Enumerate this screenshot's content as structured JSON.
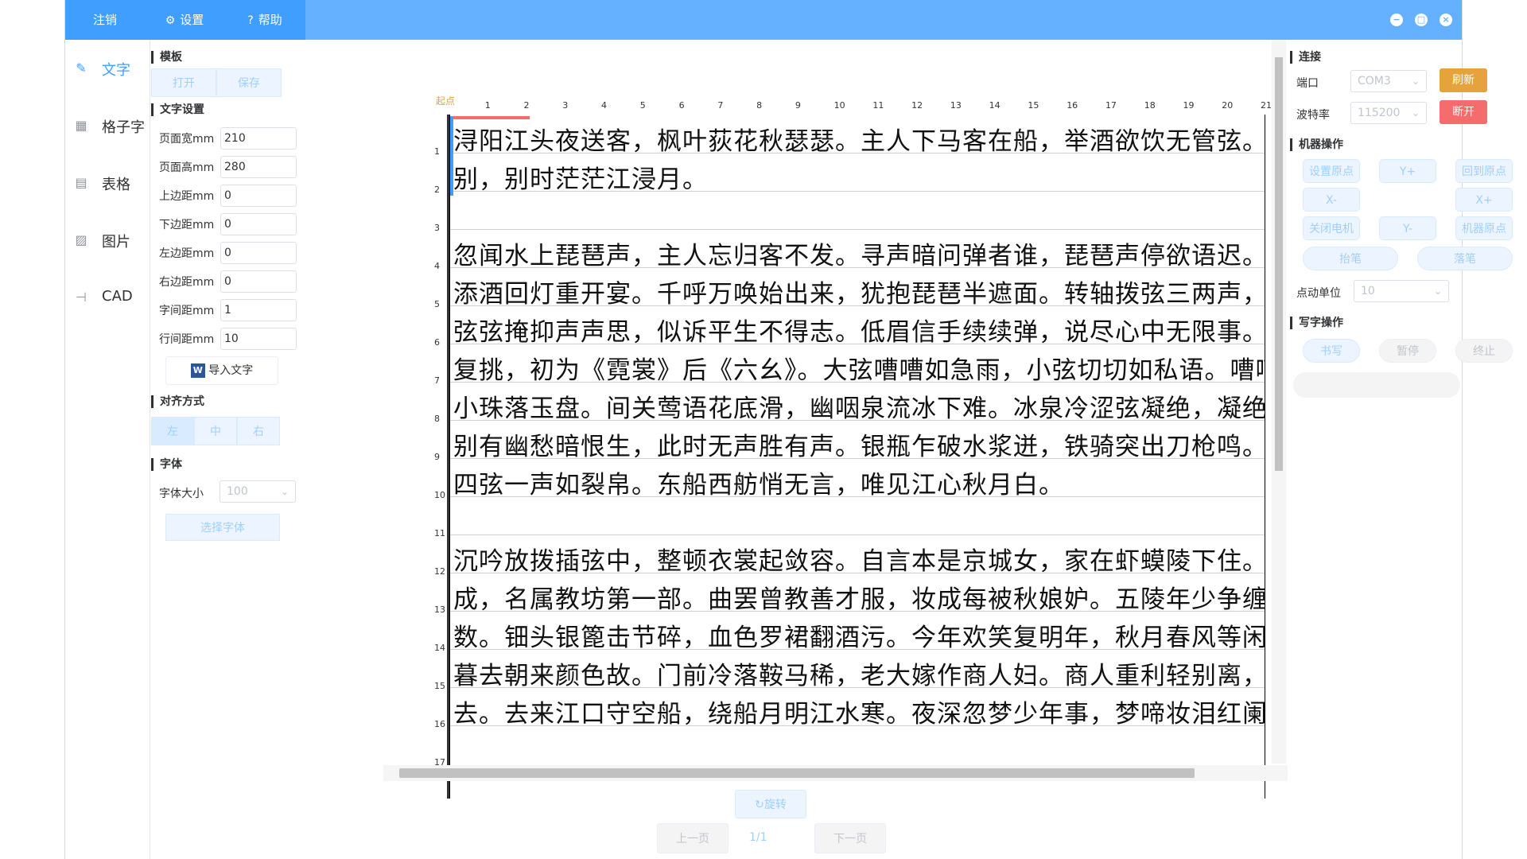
{
  "topbar": {
    "logout_label": "注销",
    "settings_label": "设置",
    "help_label": "帮助"
  },
  "nav": {
    "items": [
      {
        "label": "文字",
        "icon": "pen-icon"
      },
      {
        "label": "格子字",
        "icon": "grid-icon"
      },
      {
        "label": "表格",
        "icon": "document-icon"
      },
      {
        "label": "图片",
        "icon": "image-icon"
      },
      {
        "label": "CAD",
        "icon": "cad-icon"
      }
    ],
    "active": "文字"
  },
  "panel": {
    "template_title": "模板",
    "open_label": "打开",
    "save_label": "保存",
    "text_settings_title": "文字设置",
    "fields": [
      {
        "label": "页面宽mm",
        "value": "210"
      },
      {
        "label": "页面高mm",
        "value": "280"
      },
      {
        "label": "上边距mm",
        "value": "0"
      },
      {
        "label": "下边距mm",
        "value": "0"
      },
      {
        "label": "左边距mm",
        "value": "0"
      },
      {
        "label": "右边距mm",
        "value": "0"
      },
      {
        "label": "字间距mm",
        "value": "1"
      },
      {
        "label": "行间距mm",
        "value": "10"
      }
    ],
    "import_label": "导入文字",
    "align_title": "对齐方式",
    "align_left": "左",
    "align_center": "中",
    "align_right": "右",
    "font_title": "字体",
    "font_size_label": "字体大小",
    "font_size_value": "100",
    "choose_font_label": "选择字体"
  },
  "canvas": {
    "origin_label": "起点",
    "top_ticks": [
      "1",
      "2",
      "3",
      "4",
      "5",
      "6",
      "7",
      "8",
      "9",
      "10",
      "11",
      "12",
      "13",
      "14",
      "15",
      "16",
      "17",
      "18",
      "19",
      "20",
      "21"
    ],
    "left_ticks": [
      "1",
      "2",
      "3",
      "4",
      "5",
      "6",
      "7",
      "8",
      "9",
      "10",
      "11",
      "12",
      "13",
      "14",
      "15",
      "16",
      "17"
    ],
    "lines": [
      "浔阳江头夜送客，枫叶荻花秋瑟瑟。主人下马客在船，举酒欲饮无管弦。醉不成欢惨将",
      "别，别时茫茫江浸月。",
      "",
      "忽闻水上琵琶声，主人忘归客不发。寻声暗问弹者谁，琵琶声停欲语迟。移船相近邀相见，",
      "添酒回灯重开宴。千呼万唤始出来，犹抱琵琶半遮面。转轴拨弦三两声，未成曲调先有情。",
      "弦弦掩抑声声思，似诉平生不得志。低眉信手续续弹，说尽心中无限事。轻拢慢捻抹",
      "复挑，初为《霓裳》后《六幺》。大弦嘈嘈如急雨，小弦切切如私语。嘈嘈切切错杂弹，大珠",
      "小珠落玉盘。间关莺语花底滑，幽咽泉流冰下难。冰泉冷涩弦凝绝，凝绝不通声暂歇。",
      "别有幽愁暗恨生，此时无声胜有声。银瓶乍破水浆迸，铁骑突出刀枪鸣。曲终收拨当心画，",
      "四弦一声如裂帛。东船西舫悄无言，唯见江心秋月白。",
      "",
      "沉吟放拨插弦中，整顿衣裳起敛容。自言本是京城女，家在虾蟆陵下住。十三学得琵琶",
      "成，名属教坊第一部。曲罢曾教善才服，妆成每被秋娘妒。五陵年少争缠头，一曲红绡不知",
      "数。钿头银篦击节碎，血色罗裙翻酒污。今年欢笑复明年，秋月春风等闲度。弟走从军阿姨死，",
      "暮去朝来颜色故。门前冷落鞍马稀，老大嫁作商人妇。商人重利轻别离，前月浮梁买茶",
      "去。去来江口守空船，绕船月明江水寒。夜深忽梦少年事，梦啼妆泪红阑干。"
    ]
  },
  "bottom": {
    "rotate_label": "旋转",
    "prev_label": "上一页",
    "page_indicator": "1/1",
    "next_label": "下一页"
  },
  "right": {
    "connect_title": "连接",
    "port_label": "端口",
    "port_value": "COM3",
    "refresh_label": "刷新",
    "baud_label": "波特率",
    "baud_value": "115200",
    "disconnect_label": "断开",
    "machine_title": "机器操作",
    "set_origin_label": "设置原点",
    "y_plus_label": "Y+",
    "back_origin_label": "回到原点",
    "x_minus_label": "X-",
    "x_plus_label": "X+",
    "motor_off_label": "关闭电机",
    "y_minus_label": "Y-",
    "machine_origin_label": "机器原点",
    "pen_up_label": "抬笔",
    "pen_down_label": "落笔",
    "jog_unit_label": "点动单位",
    "jog_unit_value": "10",
    "write_title": "写字操作",
    "write_label": "书写",
    "pause_label": "暂停",
    "stop_label": "终止"
  },
  "colors": {
    "topbar": "#66b1ff",
    "primary": "#409eff",
    "orange": "#e6a23c",
    "red": "#f56c6c"
  }
}
